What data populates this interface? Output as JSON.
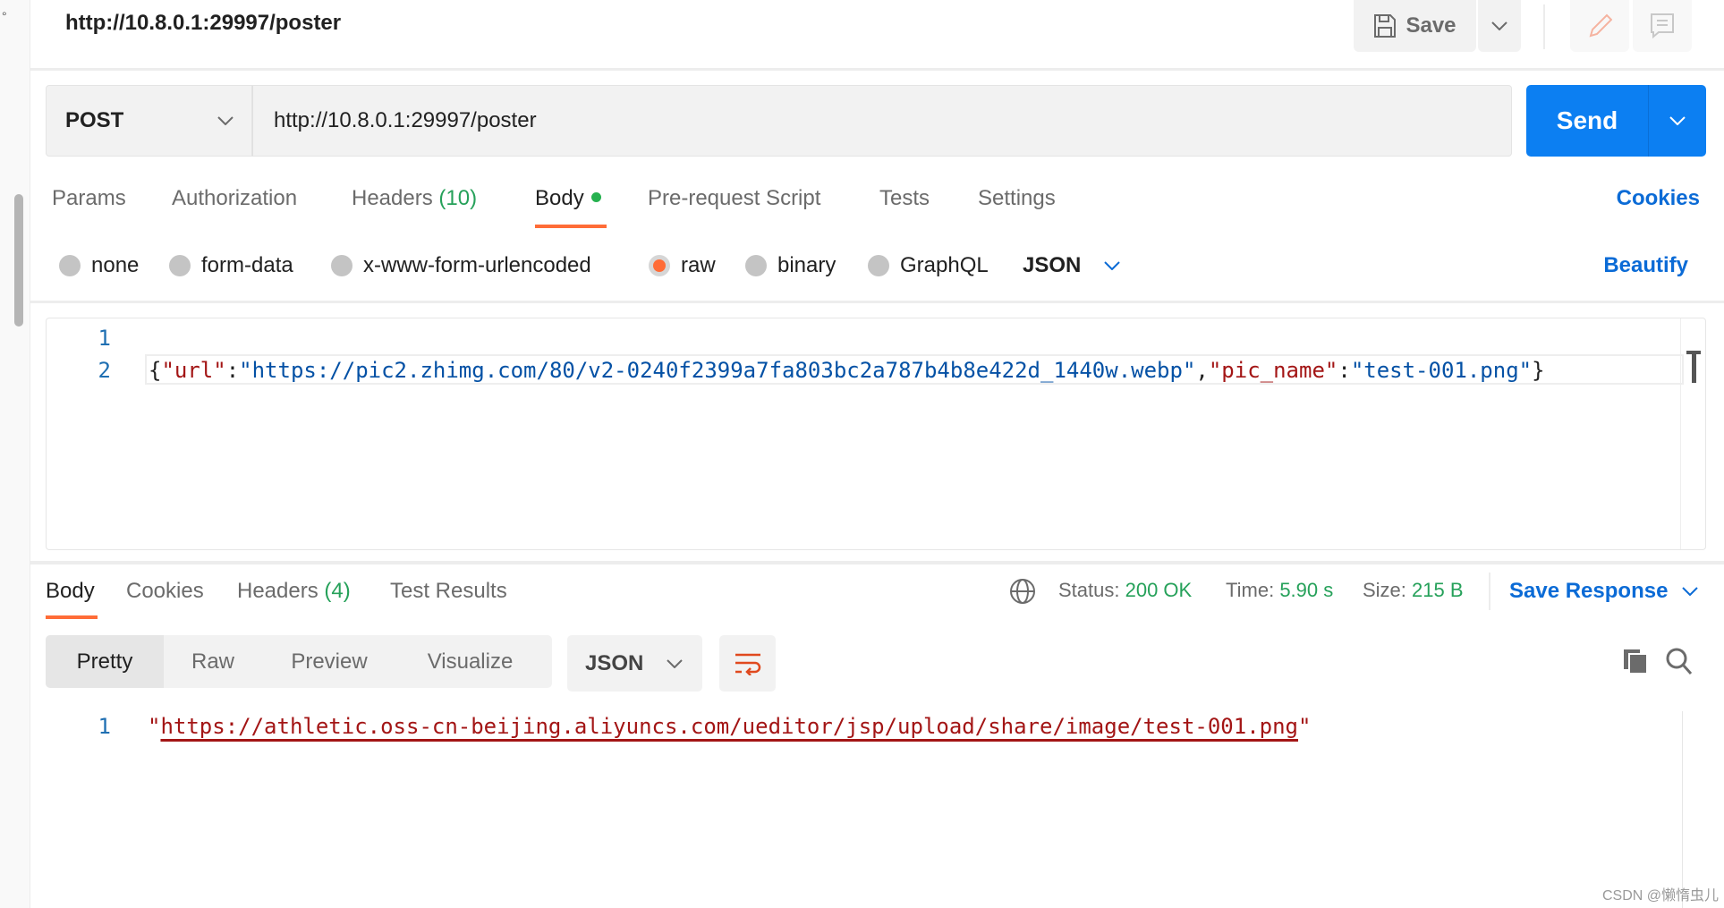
{
  "header": {
    "title": "http://10.8.0.1:29997/poster",
    "save_label": "Save"
  },
  "request": {
    "method": "POST",
    "url": "http://10.8.0.1:29997/poster",
    "send_label": "Send"
  },
  "tabs": {
    "params": "Params",
    "authorization": "Authorization",
    "headers": "Headers",
    "headers_count": "(10)",
    "body": "Body",
    "prerequest": "Pre-request Script",
    "tests": "Tests",
    "settings": "Settings",
    "cookies": "Cookies"
  },
  "body_types": {
    "none": "none",
    "form_data": "form-data",
    "urlencoded": "x-www-form-urlencoded",
    "raw": "raw",
    "binary": "binary",
    "graphql": "GraphQL",
    "format": "JSON",
    "beautify": "Beautify",
    "selected": "raw"
  },
  "editor": {
    "lines": [
      "1",
      "2"
    ],
    "code": {
      "open": "{",
      "k1": "\"url\"",
      "colon": ":",
      "v1": "\"https://pic2.zhimg.com/80/v2-0240f2399a7fa803bc2a787b4b8e422d_1440w.webp\"",
      "comma": ",",
      "k2": "\"pic_name\"",
      "v2": "\"test-001.png\"",
      "close": "}"
    }
  },
  "response": {
    "tabs": {
      "body": "Body",
      "cookies": "Cookies",
      "headers": "Headers",
      "headers_count": "(4)",
      "test_results": "Test Results"
    },
    "status_label": "Status:",
    "status": "200 OK",
    "time_label": "Time:",
    "time": "5.90 s",
    "size_label": "Size:",
    "size": "215 B",
    "save_response": "Save Response",
    "views": [
      "Pretty",
      "Raw",
      "Preview",
      "Visualize"
    ],
    "format": "JSON",
    "line": "1",
    "url": "https://athletic.oss-cn-beijing.aliyuncs.com/ueditor/jsp/upload/share/image/test-001.png",
    "quote": "\""
  },
  "colors": {
    "accent": "#ff6c37",
    "send": "#0c7ff2",
    "link": "#0b6bd6",
    "success": "#26a15a"
  },
  "watermark": "CSDN @懒惰虫儿"
}
